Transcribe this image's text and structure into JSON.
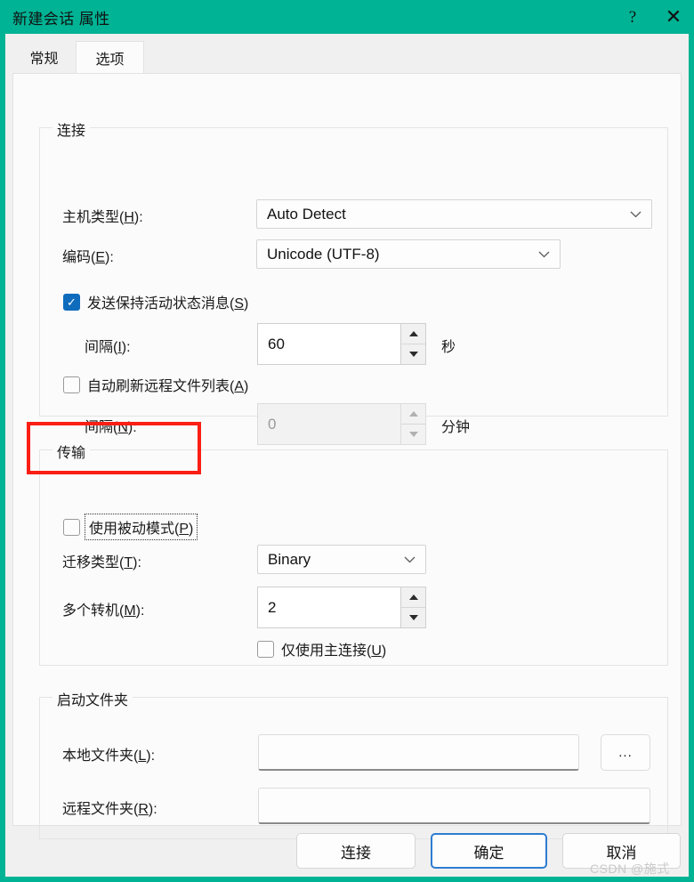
{
  "window": {
    "title": "新建会话 属性",
    "accent_color": "#00b394",
    "help_icon": "?",
    "close_icon": "✕"
  },
  "tabs": [
    {
      "label": "常规",
      "active": false
    },
    {
      "label": "选项",
      "active": true
    }
  ],
  "groups": {
    "connection": {
      "title": "连接",
      "host_type": {
        "label_prefix": "主机类型(",
        "accel": "H",
        "label_suffix": "):",
        "value": "Auto Detect",
        "chevron": "chevron-down"
      },
      "encoding": {
        "label_prefix": "编码(",
        "accel": "E",
        "label_suffix": "):",
        "value": "Unicode (UTF-8)",
        "chevron": "chevron-down"
      },
      "keepalive": {
        "label_prefix": "发送保持活动状态消息(",
        "accel": "S",
        "label_suffix": ")",
        "checked": true
      },
      "keepalive_interval": {
        "label_prefix": "间隔(",
        "accel": "I",
        "label_suffix": "):",
        "value": "60",
        "unit": "秒",
        "disabled": false
      },
      "autorefresh": {
        "label_prefix": "自动刷新远程文件列表(",
        "accel": "A",
        "label_suffix": ")",
        "checked": false
      },
      "autorefresh_interval": {
        "label_prefix": "间隔(",
        "accel": "N",
        "label_suffix": "):",
        "value": "0",
        "unit": "分钟",
        "disabled": true
      }
    },
    "transfer": {
      "title": "传输",
      "passive_mode": {
        "label_prefix": "使用被动模式(",
        "accel": "P",
        "label_suffix": ")",
        "checked": false,
        "focused": true,
        "highlight_color": "#fa1e14"
      },
      "transfer_type": {
        "label_prefix": "迁移类型(",
        "accel": "T",
        "label_suffix": "):",
        "value": "Binary",
        "chevron": "chevron-down"
      },
      "multiple_transfers": {
        "label_prefix": "多个转机(",
        "accel": "M",
        "label_suffix": "):",
        "value": "2"
      },
      "main_connection_only": {
        "label_prefix": "仅使用主连接(",
        "accel": "U",
        "label_suffix": ")",
        "checked": false
      }
    },
    "startup": {
      "title": "启动文件夹",
      "local_folder": {
        "label_prefix": "本地文件夹(",
        "accel": "L",
        "label_suffix": "):",
        "value": "",
        "browse_label": "..."
      },
      "remote_folder": {
        "label_prefix": "远程文件夹(",
        "accel": "R",
        "label_suffix": "):",
        "value": ""
      }
    }
  },
  "buttons": {
    "connect": "连接",
    "ok": "确定",
    "cancel": "取消"
  },
  "watermark": "CSDN @施式"
}
